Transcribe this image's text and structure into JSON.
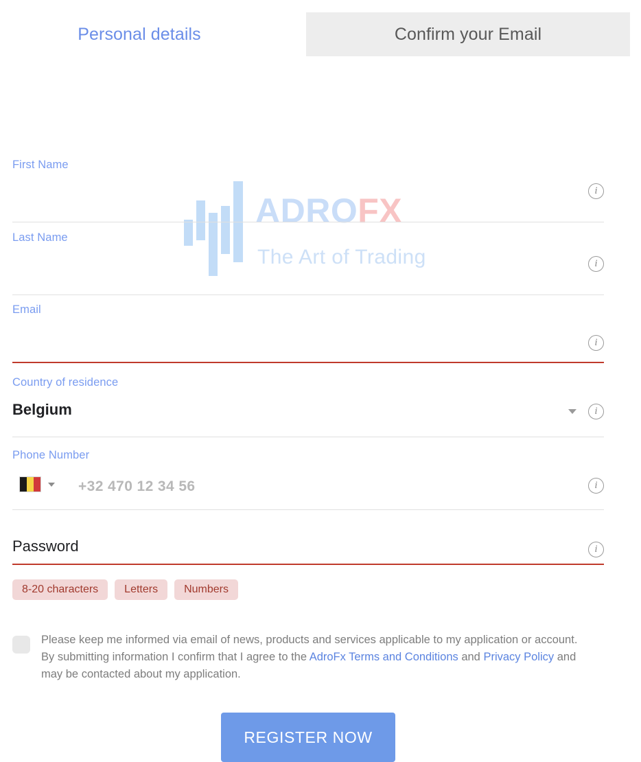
{
  "tabs": [
    {
      "id": "personal-details",
      "label": "Personal details",
      "active": true
    },
    {
      "id": "confirm-email",
      "label": "Confirm your Email",
      "active": false
    }
  ],
  "watermark": {
    "brand_primary": "ADRO",
    "brand_accent": "FX",
    "tagline": "The Art of Trading",
    "color_primary": "#c9ddf8",
    "color_accent": "#f8c4c4",
    "color_tagline": "#cde0f7",
    "color_bars": "#c2dcf7"
  },
  "fields": {
    "first_name": {
      "label": "First Name",
      "value": "",
      "info_icon": "info-icon",
      "error": false
    },
    "last_name": {
      "label": "Last Name",
      "value": "",
      "info_icon": "info-icon",
      "error": false
    },
    "email": {
      "label": "Email",
      "value": "",
      "info_icon": "info-icon",
      "error": true
    },
    "country": {
      "label": "Country of residence",
      "value": "Belgium",
      "info_icon": "info-icon",
      "dropdown_icon": "chevron-down-icon",
      "error": false
    },
    "phone": {
      "label": "Phone Number",
      "value": "",
      "placeholder": "+32 470 12 34 56",
      "country_flag": "belgium-flag-icon",
      "dropdown_icon": "chevron-down-icon",
      "info_icon": "info-icon",
      "error": false
    },
    "password": {
      "label": "Password",
      "value": "",
      "info_icon": "info-icon",
      "error": true
    }
  },
  "password_requirements": [
    {
      "label": "8-20 characters"
    },
    {
      "label": "Letters"
    },
    {
      "label": "Numbers"
    }
  ],
  "consent": {
    "text_part_1": "Please keep me informed via email of news, products and services applicable to my application or account. By submitting information I confirm that I agree to the ",
    "link_terms": "AdroFx Terms and Conditions",
    "text_part_2": " and ",
    "link_privacy": "Privacy Policy",
    "text_part_3": " and may be contacted about my application.",
    "checked": false
  },
  "submit": {
    "label": "REGISTER NOW",
    "color": "#6e9ae8"
  },
  "colors": {
    "label_blue": "#7a9cf0",
    "tab_active": "#6b8ee8",
    "tab_inactive_bg": "#ededed",
    "error_red": "#c0392b",
    "chip_bg": "#f2d7d7",
    "chip_text": "#a13a2e",
    "line_gray": "#e0e0e0"
  }
}
